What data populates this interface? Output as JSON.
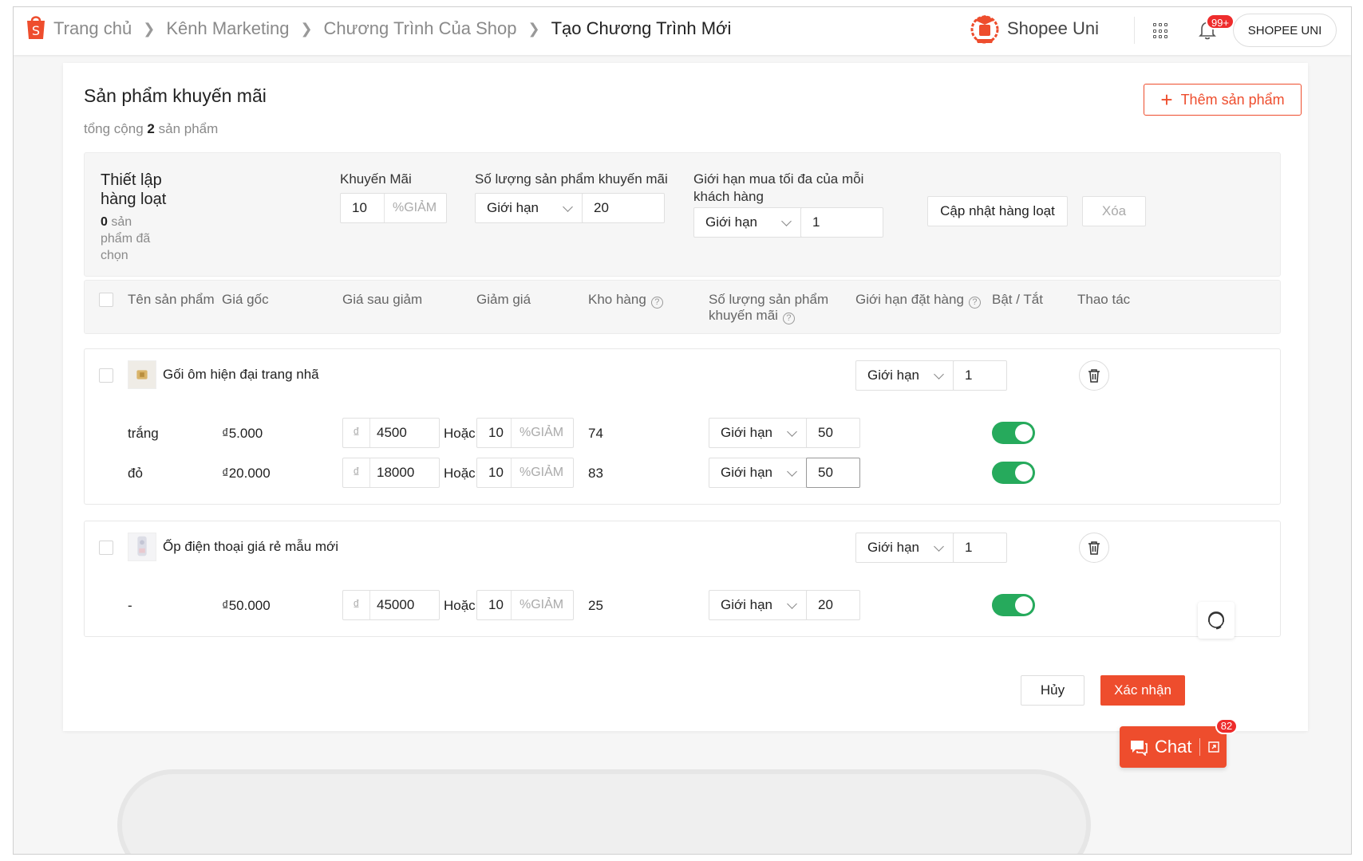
{
  "breadcrumb": [
    "Trang chủ",
    "Kênh Marketing",
    "Chương Trình Của Shop",
    "Tạo Chương Trình Mới"
  ],
  "header": {
    "brand": "Shopee Uni",
    "notif_count": "99+",
    "user": "SHOPEE UNI"
  },
  "section": {
    "title": "Sản phẩm khuyến mãi",
    "total_prefix": "tổng cộng",
    "total_count": "2",
    "total_suffix": "sản phẩm",
    "add_button": "Thêm sản phẩm"
  },
  "bulk": {
    "title": "Thiết lập hàng loạt",
    "selected_count": "0",
    "selected_text": "sản phẩm đã chọn",
    "discount_label": "Khuyến Mãi",
    "discount_value": "10",
    "discount_unit": "%GIẢM",
    "qty_label": "Số lượng sản phẩm khuyến mãi",
    "qty_select": "Giới hạn",
    "qty_value": "20",
    "limit_label": "Giới hạn mua tối đa của mỗi khách hàng",
    "limit_select": "Giới hạn",
    "limit_value": "1",
    "update_button": "Cập nhật hàng loạt",
    "delete_button": "Xóa"
  },
  "table": {
    "headers": [
      "Tên sản phẩm",
      "Giá gốc",
      "Giá sau giảm",
      "Giảm giá",
      "Kho hàng",
      "Số lượng sản phẩm khuyến mãi",
      "Giới hạn đặt hàng",
      "Bật / Tắt",
      "Thao tác"
    ]
  },
  "products": [
    {
      "name": "Gối ôm hiện đại trang nhã",
      "limit_select": "Giới hạn",
      "limit_value": "1",
      "variants": [
        {
          "name": "trắng",
          "price": "₫5.000",
          "currency": "₫",
          "sale_price": "4500",
          "or": "Hoặc",
          "discount": "10",
          "unit": "%GIẢM",
          "stock": "74",
          "qty_select": "Giới hạn",
          "qty_value": "50"
        },
        {
          "name": "đỏ",
          "price": "₫20.000",
          "currency": "₫",
          "sale_price": "18000",
          "or": "Hoặc",
          "discount": "10",
          "unit": "%GIẢM",
          "stock": "83",
          "qty_select": "Giới hạn",
          "qty_value": "50"
        }
      ]
    },
    {
      "name": "Ốp điện thoại giá rẻ mẫu mới",
      "limit_select": "Giới hạn",
      "limit_value": "1",
      "variants": [
        {
          "name": "-",
          "price": "₫50.000",
          "currency": "₫",
          "sale_price": "45000",
          "or": "Hoặc",
          "discount": "10",
          "unit": "%GIẢM",
          "stock": "25",
          "qty_select": "Giới hạn",
          "qty_value": "20"
        }
      ]
    }
  ],
  "footer": {
    "cancel": "Hủy",
    "confirm": "Xác nhận"
  },
  "chat": {
    "label": "Chat",
    "badge": "82"
  },
  "colors": {
    "accent": "#ee4d2d",
    "toggle_on": "#26aa5c"
  }
}
